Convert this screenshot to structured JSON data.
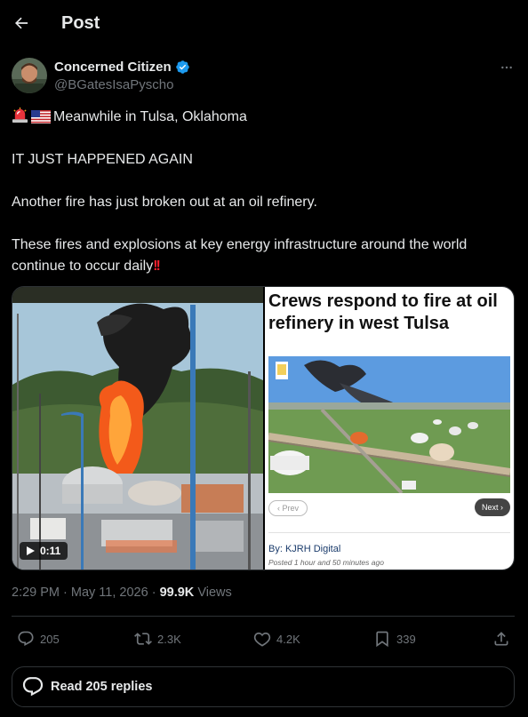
{
  "header": {
    "title": "Post",
    "back_icon": "arrow-left-icon"
  },
  "author": {
    "display_name": "Concerned Citizen",
    "handle": "@BGatesIsaPyscho",
    "verified": true,
    "verified_color": "#1d9bf0"
  },
  "tweet": {
    "line1_emojis": [
      "rotating-light-emoji",
      "us-flag-emoji"
    ],
    "line1": "Meanwhile in Tulsa, Oklahoma",
    "line2": "IT JUST HAPPENED AGAIN",
    "line3": "Another fire has just broken out at an oil refinery.",
    "line4": "These fires and explosions at key energy infrastructure around the world",
    "line5": "continue to occur daily",
    "line5_emoji": "double-exclamation-emoji"
  },
  "media": {
    "video_duration": "0:11",
    "news_headline": "Crews respond to fire at oil refinery in west Tulsa",
    "news_prev": "Prev",
    "news_next": "Next",
    "news_byline": "By: KJRH Digital",
    "news_posted": "Posted 1 hour and 50 minutes ago"
  },
  "meta": {
    "time": "2:29 PM",
    "date": "May 11, 2026",
    "views_count": "99.9K",
    "views_label": "Views"
  },
  "actions": {
    "replies": "205",
    "reposts": "2.3K",
    "likes": "4.2K",
    "bookmarks": "339"
  },
  "read_replies_label": "Read 205 replies",
  "colors": {
    "background": "#000000",
    "text": "#e7e9ea",
    "muted": "#71767b",
    "border": "#2f3336",
    "accent": "#1d9bf0"
  }
}
